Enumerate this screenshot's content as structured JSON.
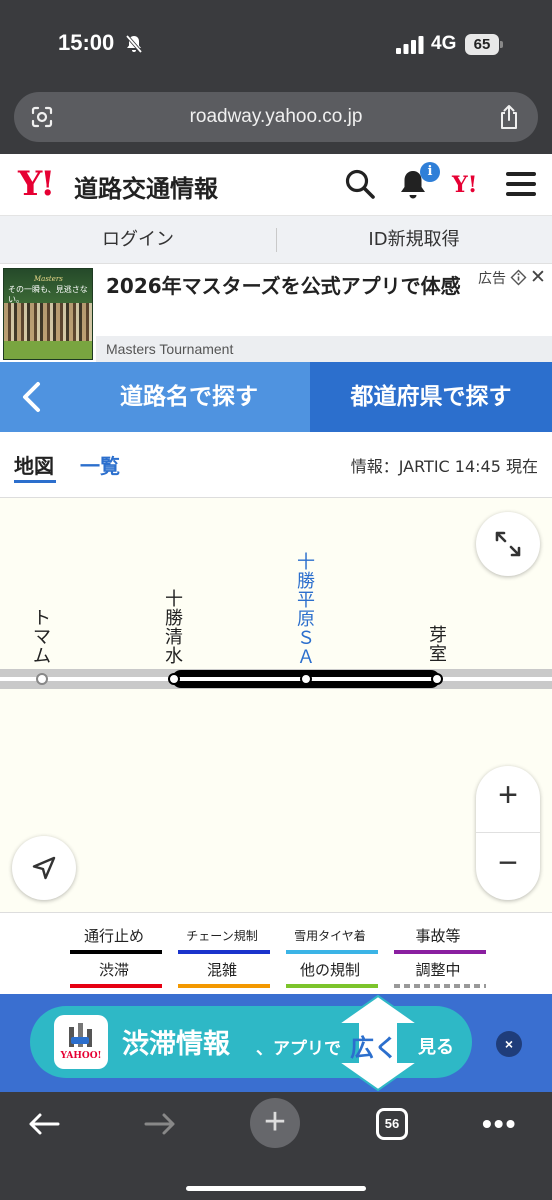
{
  "status_bar": {
    "time": "15:00",
    "network": "4G",
    "battery": "65"
  },
  "browser": {
    "url": "roadway.yahoo.co.jp",
    "tab_count": "56"
  },
  "header": {
    "logo_mark": "Y!",
    "title": "道路交通情報",
    "notification_count": "i",
    "yahoo_mark": "Y!"
  },
  "account": {
    "login": "ログイン",
    "register": "ID新規取得"
  },
  "ad": {
    "title": "2026年マスターズを公式アプリで体感",
    "sponsor": "Masters Tournament",
    "label": "広告",
    "image_logo": "Masters",
    "image_caption": "その一瞬も、見逃さない。"
  },
  "search_tabs": {
    "road": "道路名で探す",
    "prefecture": "都道府県で探す"
  },
  "view_tabs": {
    "map": "地図",
    "list": "一覧",
    "info": "情報：JARTIC 14:45 現在"
  },
  "map": {
    "points": [
      {
        "name": "トマム"
      },
      {
        "name": "十勝清水"
      },
      {
        "name": "十勝平原ＳＡ"
      },
      {
        "name": "芽室"
      }
    ],
    "congestion_segment": "十勝清水 – 芽室",
    "zoom_in": "+",
    "zoom_out": "−"
  },
  "legend": {
    "items": [
      {
        "label": "通行止め",
        "color": "#000000"
      },
      {
        "label": "チェーン規制",
        "color": "#1a33cc"
      },
      {
        "label": "雪用タイヤ着",
        "color": "#3bb4e6"
      },
      {
        "label": "事故等",
        "color": "#8a1fa0"
      },
      {
        "label": "渋滞",
        "color": "#e60012"
      },
      {
        "label": "混雑",
        "color": "#f39800"
      },
      {
        "label": "他の規制",
        "color": "#7cc42b"
      },
      {
        "label": "調整中",
        "color": "#999999"
      }
    ]
  },
  "app_banner": {
    "title": "渋滞情報",
    "sub": "、アプリで",
    "highlight": "広く",
    "see": "見る",
    "app_name": "YAHOO!",
    "close": "×"
  },
  "colors": {
    "accent": "#2c6fcd",
    "tab_light": "#4f93e0",
    "brand_red": "#e60033",
    "banner_bg": "#3a6fd0",
    "banner_pill": "#2eb8c6"
  }
}
